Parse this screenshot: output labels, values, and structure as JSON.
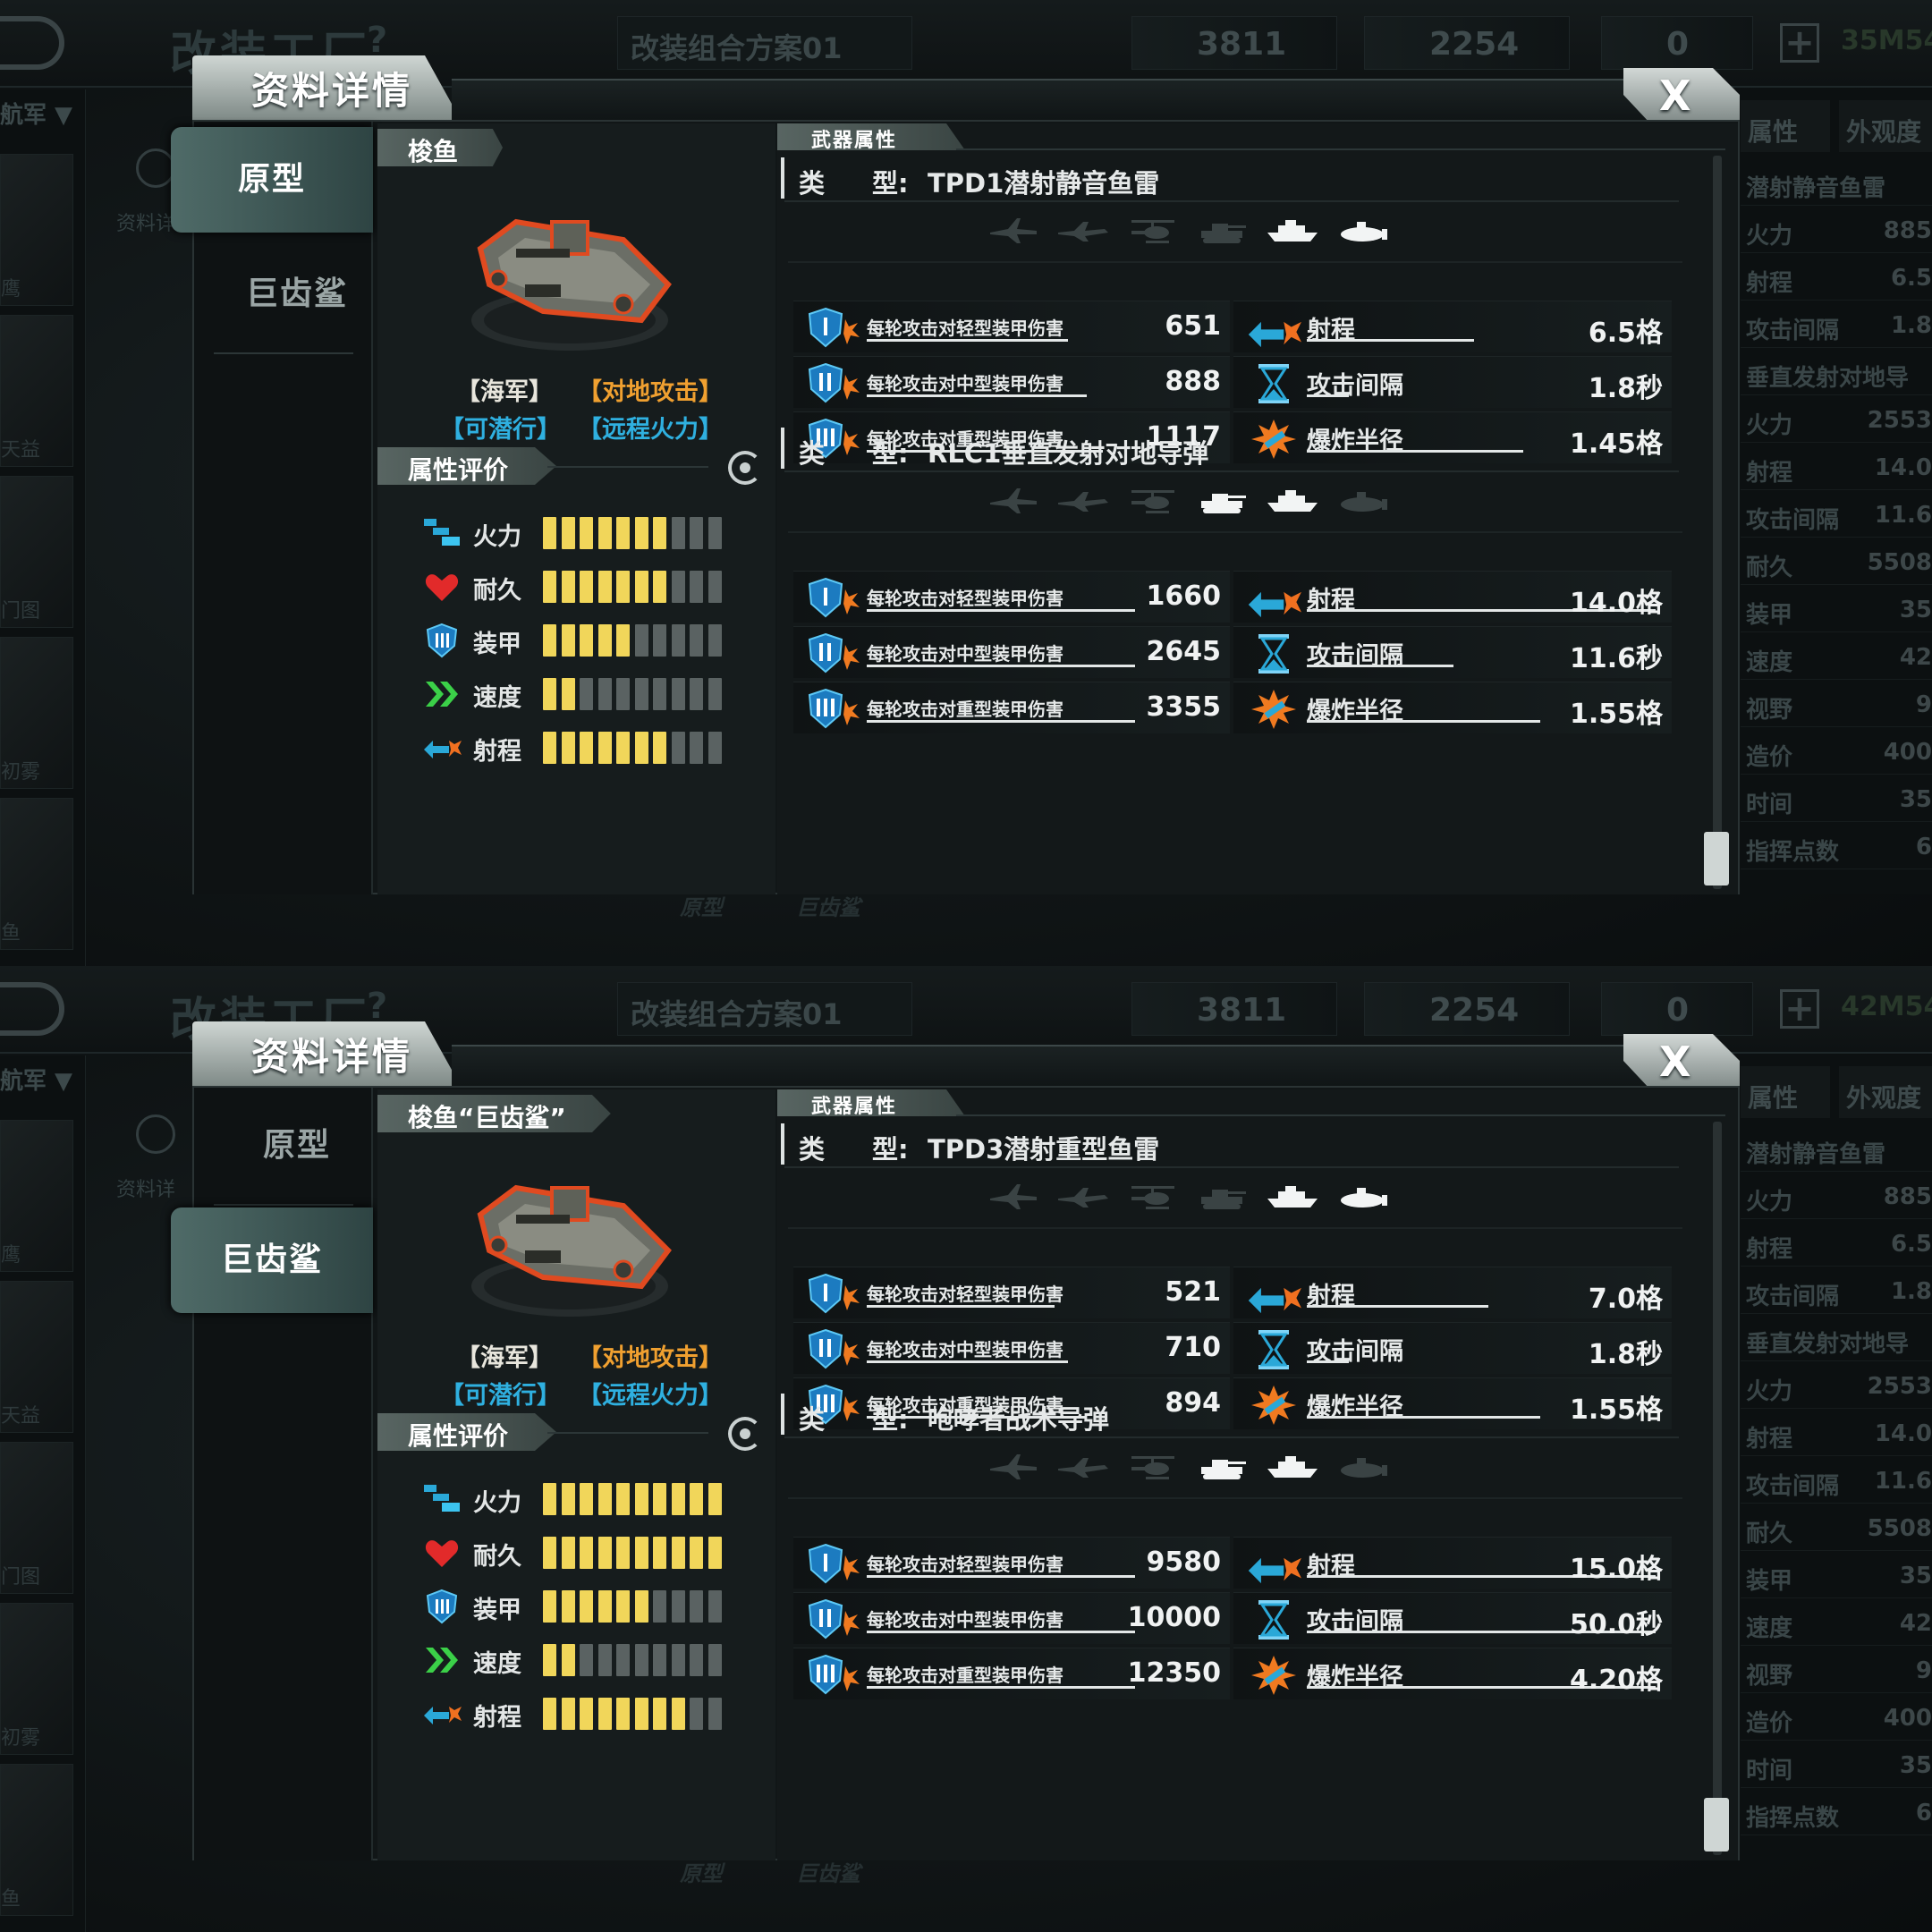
{
  "background": {
    "title": "改装工厂",
    "help": "?",
    "scheme": "改装组合方案01",
    "gold": "3811",
    "gems": "2254",
    "cards": "0",
    "plus": "+",
    "codes": [
      "35M54",
      "42M54"
    ],
    "navy_label": "航军 ▼",
    "info_label": "资料详",
    "side_labels": [
      "鹰",
      "天益",
      "门图",
      "初雾",
      "鱼"
    ],
    "right_tabs": [
      "属性",
      "外观度"
    ],
    "right_rows": [
      {
        "l": "潜射静音鱼雷",
        "v": ""
      },
      {
        "l": "火力",
        "v": "885"
      },
      {
        "l": "射程",
        "v": "6.5"
      },
      {
        "l": "攻击间隔",
        "v": "1.8"
      },
      {
        "l": "垂直发射对地导",
        "v": ""
      },
      {
        "l": "火力",
        "v": "2553"
      },
      {
        "l": "射程",
        "v": "14.0"
      },
      {
        "l": "攻击间隔",
        "v": "11.6"
      },
      {
        "l": "耐久",
        "v": "5508"
      },
      {
        "l": "装甲",
        "v": "35"
      },
      {
        "l": "速度",
        "v": "42"
      },
      {
        "l": "视野",
        "v": "9"
      },
      {
        "l": "造价",
        "v": "400"
      },
      {
        "l": "时间",
        "v": "35"
      },
      {
        "l": "指挥点数",
        "v": "6"
      }
    ],
    "bottom": [
      "原型",
      "巨齿鲨"
    ]
  },
  "panels": [
    {
      "modal_title": "资料详情",
      "close": "X",
      "tabs": [
        "原型",
        "巨齿鲨"
      ],
      "active_tab": 0,
      "unit_name": "梭鱼",
      "tags": {
        "navy": "【海军】",
        "ground": "【对地攻击】",
        "sub": "【可潜行】",
        "range": "【远程火力】"
      },
      "rating_title": "属性评价",
      "ratings": [
        {
          "label": "火力",
          "value": 7,
          "max": 10
        },
        {
          "label": "耐久",
          "value": 7,
          "max": 10
        },
        {
          "label": "装甲",
          "value": 5,
          "max": 10
        },
        {
          "label": "速度",
          "value": 2,
          "max": 10
        },
        {
          "label": "射程",
          "value": 7,
          "max": 10
        }
      ],
      "weapons_title": "武器属性",
      "weapons": [
        {
          "type_key": "类",
          "type_key2": "型:",
          "type_name": "TPD1潜射静音鱼雷",
          "targets": [
            false,
            false,
            false,
            false,
            true,
            true
          ],
          "dmg": [
            {
              "label": "每轮攻击对轻型装甲伤害",
              "value": "651",
              "fill": 0.75
            },
            {
              "label": "每轮攻击对中型装甲伤害",
              "value": "888",
              "fill": 0.82
            },
            {
              "label": "每轮攻击对重型装甲伤害",
              "value": "1117",
              "fill": 0.88
            }
          ],
          "props": [
            {
              "label": "射程",
              "value": "6.5格",
              "fill": 0.48
            },
            {
              "label": "攻击间隔",
              "value": "1.8秒",
              "fill": 0.12
            },
            {
              "label": "爆炸半径",
              "value": "1.45格",
              "fill": 0.62
            }
          ]
        },
        {
          "type_key": "类",
          "type_key2": "型:",
          "type_name": "RLC1垂直发射对地导弹",
          "targets": [
            false,
            false,
            false,
            true,
            true,
            false
          ],
          "dmg": [
            {
              "label": "每轮攻击对轻型装甲伤害",
              "value": "1660",
              "fill": 1.0
            },
            {
              "label": "每轮攻击对中型装甲伤害",
              "value": "2645",
              "fill": 1.0
            },
            {
              "label": "每轮攻击对重型装甲伤害",
              "value": "3355",
              "fill": 1.0
            }
          ],
          "props": [
            {
              "label": "射程",
              "value": "14.0格",
              "fill": 1.0
            },
            {
              "label": "攻击间隔",
              "value": "11.6秒",
              "fill": 0.42
            },
            {
              "label": "爆炸半径",
              "value": "1.55格",
              "fill": 0.67
            }
          ]
        }
      ]
    },
    {
      "modal_title": "资料详情",
      "close": "X",
      "tabs": [
        "原型",
        "巨齿鲨"
      ],
      "active_tab": 1,
      "unit_name": "梭鱼“巨齿鲨”",
      "tags": {
        "navy": "【海军】",
        "ground": "【对地攻击】",
        "sub": "【可潜行】",
        "range": "【远程火力】"
      },
      "rating_title": "属性评价",
      "ratings": [
        {
          "label": "火力",
          "value": 10,
          "max": 10
        },
        {
          "label": "耐久",
          "value": 10,
          "max": 10
        },
        {
          "label": "装甲",
          "value": 6,
          "max": 10
        },
        {
          "label": "速度",
          "value": 2,
          "max": 10
        },
        {
          "label": "射程",
          "value": 8,
          "max": 10
        }
      ],
      "weapons_title": "武器属性",
      "weapons": [
        {
          "type_key": "类",
          "type_key2": "型:",
          "type_name": "TPD3潜射重型鱼雷",
          "targets": [
            false,
            false,
            false,
            false,
            true,
            true
          ],
          "dmg": [
            {
              "label": "每轮攻击对轻型装甲伤害",
              "value": "521",
              "fill": 0.7
            },
            {
              "label": "每轮攻击对中型装甲伤害",
              "value": "710",
              "fill": 0.75
            },
            {
              "label": "每轮攻击对重型装甲伤害",
              "value": "894",
              "fill": 0.82
            }
          ],
          "props": [
            {
              "label": "射程",
              "value": "7.0格",
              "fill": 0.52
            },
            {
              "label": "攻击间隔",
              "value": "1.8秒",
              "fill": 0.12
            },
            {
              "label": "爆炸半径",
              "value": "1.55格",
              "fill": 0.67
            }
          ]
        },
        {
          "type_key": "类",
          "type_key2": "型:",
          "type_name": "咆哮者战术导弹",
          "targets": [
            false,
            false,
            false,
            true,
            true,
            false
          ],
          "dmg": [
            {
              "label": "每轮攻击对轻型装甲伤害",
              "value": "9580",
              "fill": 1.0
            },
            {
              "label": "每轮攻击对中型装甲伤害",
              "value": "10000",
              "fill": 1.0
            },
            {
              "label": "每轮攻击对重型装甲伤害",
              "value": "12350",
              "fill": 1.0
            }
          ],
          "props": [
            {
              "label": "射程",
              "value": "15.0格",
              "fill": 1.0
            },
            {
              "label": "攻击间隔",
              "value": "50.0秒",
              "fill": 1.0
            },
            {
              "label": "爆炸半径",
              "value": "4.20格",
              "fill": 1.0
            }
          ]
        }
      ]
    }
  ],
  "colors": {
    "tag_navy": "#e8e6dd",
    "tag_ground": "#f0a030",
    "tag_blue": "#2fb0e0",
    "bar_on": "#f1d65a",
    "bar_off": "#5a6262",
    "tab_active": "#4f6b68"
  }
}
